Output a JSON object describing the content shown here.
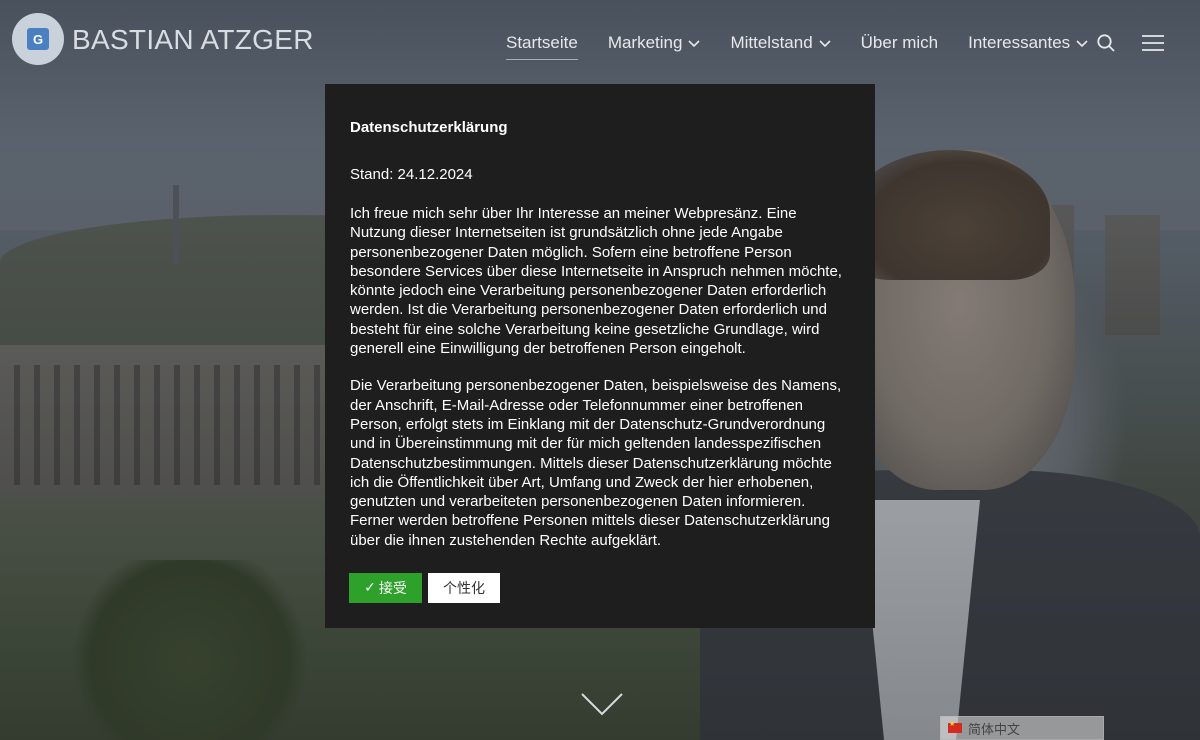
{
  "header": {
    "site_title": "BASTIAN ATZGER",
    "logo_letter": "G"
  },
  "nav": {
    "items": [
      {
        "label": "Startseite",
        "active": true,
        "has_dropdown": false
      },
      {
        "label": "Marketing",
        "active": false,
        "has_dropdown": true
      },
      {
        "label": "Mittelstand",
        "active": false,
        "has_dropdown": true
      },
      {
        "label": "Über mich",
        "active": false,
        "has_dropdown": false
      },
      {
        "label": "Interessantes",
        "active": false,
        "has_dropdown": true
      }
    ],
    "search_icon": "search-icon",
    "menu_icon": "hamburger-menu-icon"
  },
  "modal": {
    "title": "Datenschutzerklärung",
    "stand": "Stand: 24.12.2024",
    "paragraph_1": "Ich freue mich sehr über Ihr Interesse an meiner Webpresänz. Eine Nutzung dieser Internetseiten ist grundsätzlich ohne jede Angabe personenbezogener Daten möglich. Sofern eine betroffene Person besondere Services über diese Internetseite in Anspruch nehmen möchte, könnte jedoch eine Verarbeitung personenbezogener Daten erforderlich werden. Ist die Verarbeitung personenbezogener Daten erforderlich und besteht für eine solche Verarbeitung keine gesetzliche Grundlage, wird generell eine Einwilligung der betroffenen Person eingeholt.",
    "paragraph_2": "Die Verarbeitung personenbezogener Daten, beispielsweise des Namens, der Anschrift, E-Mail-Adresse oder Telefonnummer einer betroffenen Person, erfolgt stets im Einklang mit der Datenschutz-Grundverordnung und in Übereinstimmung mit der für mich geltenden landesspezifischen Datenschutzbestimmungen. Mittels dieser Datenschutzerklärung möchte ich die Öffentlichkeit über Art, Umfang und Zweck der hier erhobenen, genutzten und verarbeiteten personenbezogenen Daten informieren. Ferner werden betroffene Personen mittels dieser Datenschutzerklärung über die ihnen zustehenden Rechte aufgeklärt.",
    "accept_label": "接受",
    "accept_icon": "✓",
    "customize_label": "个性化",
    "accept_color": "#2ea12a"
  },
  "language": {
    "selected": "简体中文",
    "flag_icon": "china-flag-icon"
  },
  "scroll_icon": "chevron-down-icon"
}
